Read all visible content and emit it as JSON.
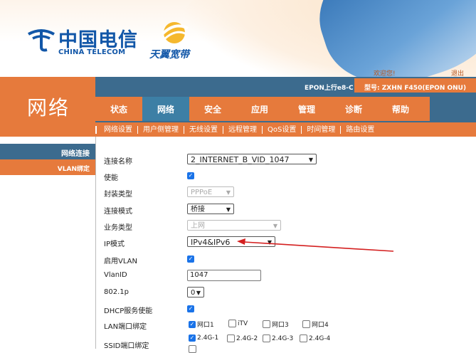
{
  "header": {
    "logo_cn": "中国电信",
    "logo_en": "CHINA TELECOM",
    "logo_tianyi": "天翼宽带",
    "welcome": "欢迎您!",
    "logout": "退出",
    "uplink": "EPON上行e8-C",
    "model": "型号: ZXHN F450(EPON ONU)",
    "section_title": "网络"
  },
  "nav": {
    "tabs": [
      "状态",
      "网络",
      "安全",
      "应用",
      "管理",
      "诊断",
      "帮助"
    ],
    "active_tab": "网络",
    "subtabs": [
      "网络设置",
      "用户侧管理",
      "无线设置",
      "远程管理",
      "QoS设置",
      "时间管理",
      "路由设置"
    ]
  },
  "sidebar": {
    "items": [
      "网络连接",
      "VLAN绑定"
    ]
  },
  "form": {
    "conn_name_label": "连接名称",
    "conn_name_value": "2_INTERNET_B_VID_1047",
    "enable_label": "使能",
    "encap_label": "封装类型",
    "encap_value": "PPPoE",
    "conn_mode_label": "连接模式",
    "conn_mode_value": "桥接",
    "service_label": "业务类型",
    "service_value": "上网",
    "ip_mode_label": "IP模式",
    "ip_mode_value": "IPv4&IPv6",
    "vlan_enable_label": "启用VLAN",
    "vlan_id_label": "VlanID",
    "vlan_id_value": "1047",
    "dot1p_label": "802.1p",
    "dot1p_value": "0",
    "dhcp_label": "DHCP服务使能",
    "lan_bind_label": "LAN端口绑定",
    "lan_ports": [
      "网口1",
      "iTV",
      "网口3",
      "网口4"
    ],
    "ssid_bind_label": "SSID端口绑定",
    "ssid_ports": [
      "2.4G-1",
      "2.4G-2",
      "2.4G-3",
      "2.4G-4"
    ]
  },
  "colors": {
    "accent_orange": "#e67a3c",
    "nav_blue": "#3c6b8e",
    "checkbox_blue": "#1a73e8",
    "annotation_red": "#d42020"
  }
}
